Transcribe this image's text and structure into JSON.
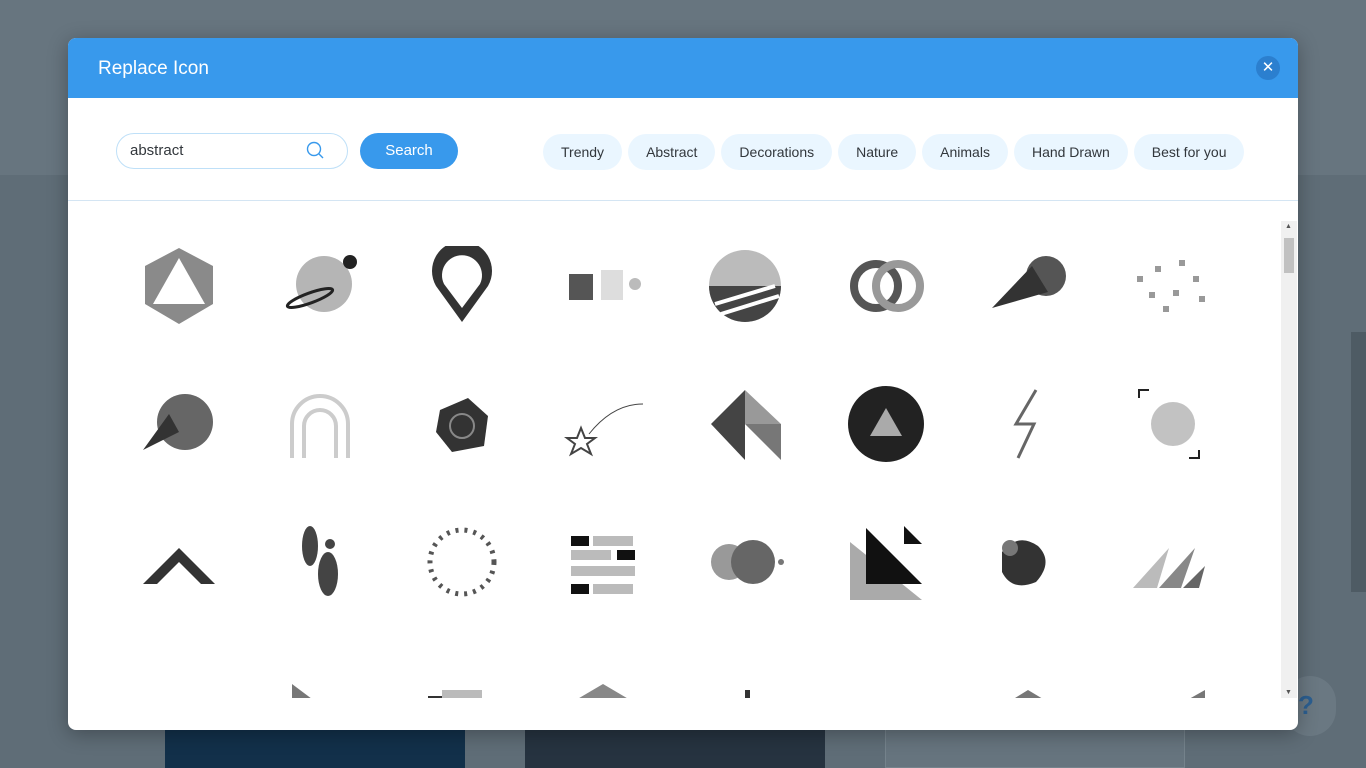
{
  "dialog": {
    "title": "Replace Icon",
    "close_icon": "close-icon"
  },
  "search": {
    "value": "abstract",
    "placeholder": "",
    "button_label": "Search",
    "icon": "search-icon"
  },
  "tags": [
    "Trendy",
    "Abstract",
    "Decorations",
    "Nature",
    "Animals",
    "Hand Drawn",
    "Best for you"
  ],
  "help": {
    "label": "?"
  },
  "colors": {
    "accent": "#3899ec",
    "tag_bg": "#eaf6ff",
    "icon_gray": "#4a4a4a"
  },
  "icons": [
    "hexagon-triangle",
    "planet-ring",
    "location-pin",
    "squares-dots",
    "striped-circle",
    "linked-rings",
    "comet",
    "scattered-shapes",
    "striped-planet",
    "hand-drawn-arch",
    "wood-ring",
    "shooting-star",
    "geometric-bird",
    "dark-circle-triangle",
    "lightning",
    "dotted-fingerprint",
    "mountain-stripes",
    "abstract-figure",
    "dotted-circle",
    "dashed-blocks",
    "overlapping-circles",
    "black-triangles",
    "blob-wind",
    "peaks",
    "parallelograms",
    "triangle-mosaic",
    "stacked-bars",
    "house-hexagon",
    "bar-lines",
    "semicircles",
    "cubes",
    "blocks-perspective"
  ]
}
